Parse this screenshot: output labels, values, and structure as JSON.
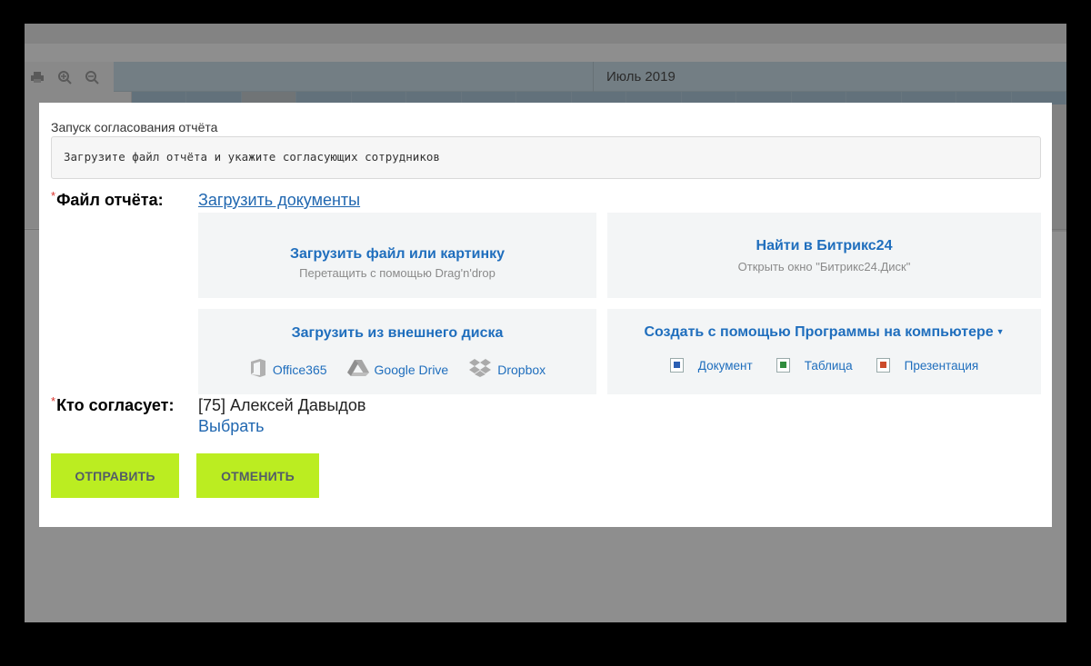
{
  "background": {
    "month_title": "Июль 2019",
    "toolbar_icons": [
      "print-icon",
      "zoom-in-icon",
      "zoom-out-icon"
    ]
  },
  "dialog": {
    "title": "Запуск согласования отчёта",
    "description": "Загрузите файл отчёта и укажите согласующих сотрудников",
    "file_field": {
      "required_mark": "*",
      "label": "Файл отчёта:",
      "upload_link": "Загрузить документы"
    },
    "upload_box": {
      "title": "Загрузить файл или картинку",
      "subtitle": "Перетащить с помощью Drag'n'drop"
    },
    "find_box": {
      "title": "Найти в Битрикс24",
      "subtitle": "Открыть окно \"Битрикс24.Диск\""
    },
    "external_box": {
      "title": "Загрузить из внешнего диска",
      "options": [
        "Office365",
        "Google Drive",
        "Dropbox"
      ]
    },
    "create_box": {
      "title": "Создать с помощью Программы на компьютере",
      "options": [
        "Документ",
        "Таблица",
        "Презентация"
      ]
    },
    "approver_field": {
      "required_mark": "*",
      "label": "Кто согласует:",
      "value": "[75] Алексей Давыдов",
      "choose_link": "Выбрать"
    },
    "buttons": {
      "send": "ОТПРАВИТЬ",
      "cancel": "ОТМЕНИТЬ"
    }
  },
  "colors": {
    "accent_green": "#bbed21",
    "link_blue": "#2067b0",
    "required_red": "#d9322b"
  }
}
